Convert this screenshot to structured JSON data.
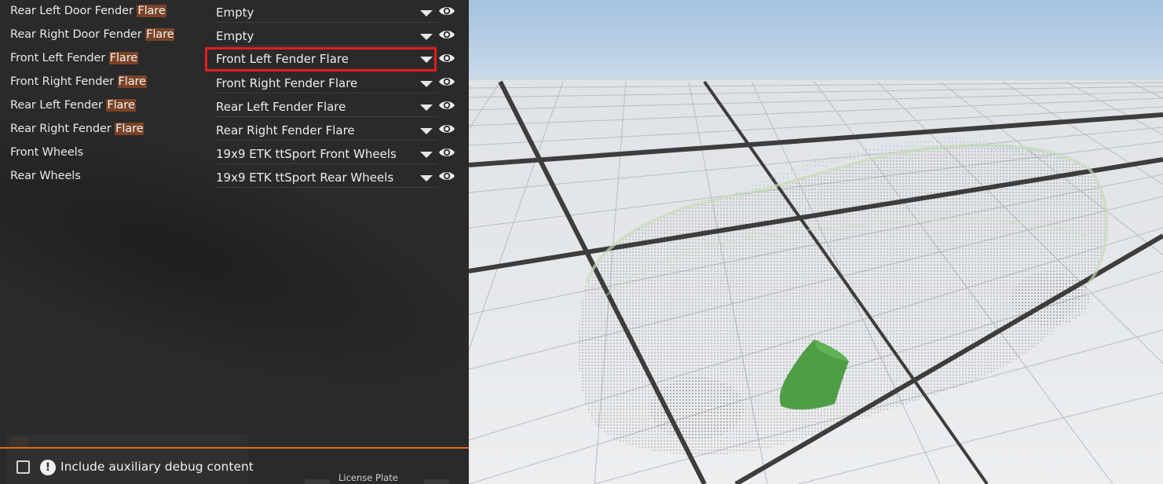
{
  "parts": [
    {
      "label_prefix": "Rear Left Door Fender ",
      "label_highlight": "Flare",
      "value": "Empty",
      "active": false
    },
    {
      "label_prefix": "Rear Right Door Fender ",
      "label_highlight": "Flare",
      "value": "Empty",
      "active": false
    },
    {
      "label_prefix": "Front Left Fender ",
      "label_highlight": "Flare",
      "value": "Front Left Fender Flare",
      "active": true
    },
    {
      "label_prefix": "Front Right Fender ",
      "label_highlight": "Flare",
      "value": "Front Right Fender Flare",
      "active": false
    },
    {
      "label_prefix": "Rear Left Fender ",
      "label_highlight": "Flare",
      "value": "Rear Left Fender Flare",
      "active": false
    },
    {
      "label_prefix": "Rear Right Fender ",
      "label_highlight": "Flare",
      "value": "Rear Right Fender Flare",
      "active": false
    },
    {
      "label_prefix": "Front Wheels",
      "label_highlight": "",
      "value": "19x9 ETK ttSport Front Wheels",
      "active": false
    },
    {
      "label_prefix": "Rear Wheels",
      "label_highlight": "",
      "value": "19x9 ETK ttSport Rear Wheels",
      "active": false
    }
  ],
  "footer": {
    "checkbox_label": "Include auxiliary debug content",
    "warn_glyph": "!",
    "plate_label": "License Plate"
  },
  "colors": {
    "highlight": "#7a4326",
    "accent_line": "#e46a1a",
    "active_outline": "#e41d1d",
    "selected_part": "#4f9e46"
  },
  "icons": {
    "visibility": "eye-icon",
    "dropdown": "caret-down-icon",
    "warning": "warning-circle-icon"
  }
}
